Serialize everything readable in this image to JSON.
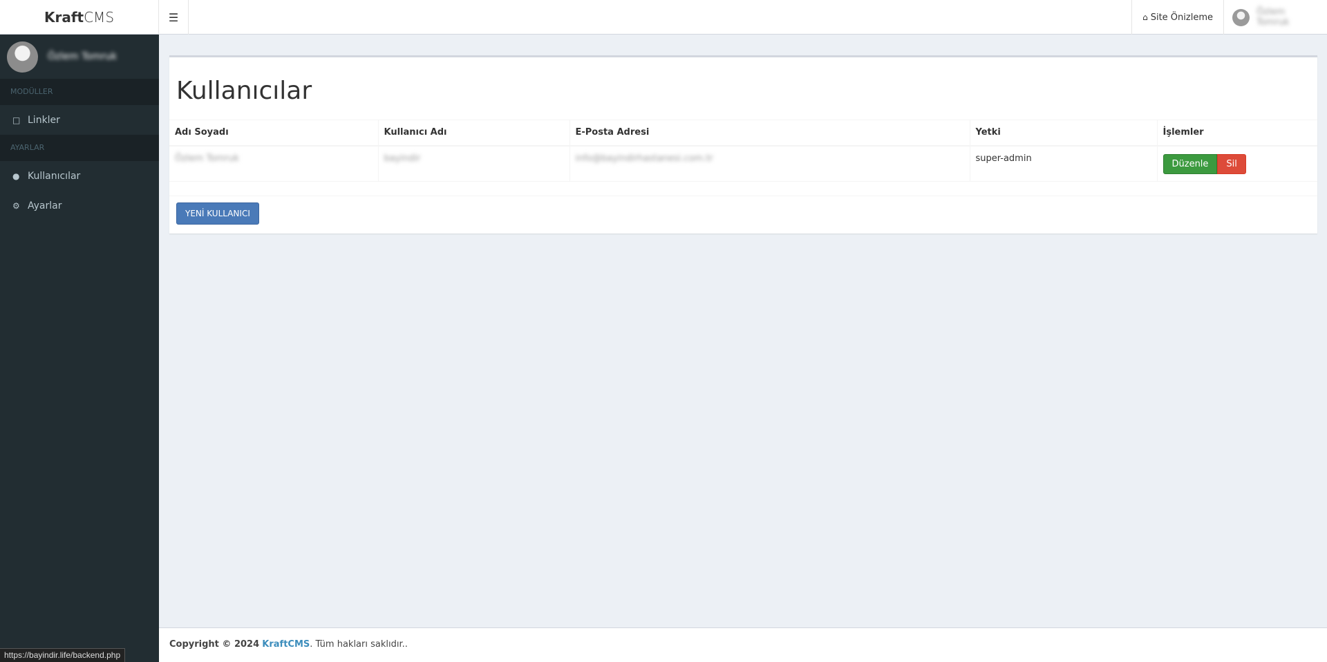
{
  "header": {
    "logo_bold": "Kraft",
    "logo_light": "CMS",
    "toggle_icon": "hamburger-menu-icon",
    "site_preview_label": "Site Önizleme",
    "site_preview_icon": "home-icon",
    "user_name": "Özlem Tomruk"
  },
  "sidebar": {
    "user_name": "Özlem Tomruk",
    "sections": [
      {
        "header": "MODÜLLER",
        "items": [
          {
            "label": "Linkler",
            "icon": "note-icon"
          }
        ]
      },
      {
        "header": "AYARLAR",
        "items": [
          {
            "label": "Kullanıcılar",
            "icon": "user-icon"
          },
          {
            "label": "Ayarlar",
            "icon": "gear-icon"
          }
        ]
      }
    ]
  },
  "main": {
    "title": "Kullanıcılar",
    "table": {
      "columns": [
        "Adı Soyadı",
        "Kullanıcı Adı",
        "E-Posta Adresi",
        "Yetki",
        "İşlemler"
      ],
      "rows": [
        {
          "name": "Özlem Tomruk",
          "username": "bayindir",
          "email": "info@bayindirhastanesi.com.tr",
          "role": "super-admin",
          "edit_label": "Düzenle",
          "delete_label": "Sil"
        }
      ]
    },
    "new_user_label": "YENİ KULLANICI"
  },
  "footer": {
    "copyright": "Copyright © 2024",
    "brand": "KraftCMS",
    "rights": ". Tüm hakları saklıdır.."
  },
  "statusbar": {
    "url": "https://bayindir.life/backend.php"
  },
  "colors": {
    "sidebar_bg": "#222d32",
    "success": "#3c9a3f",
    "danger": "#dd4b39",
    "primary": "#4a7ab8",
    "link": "#3c8dbc"
  }
}
